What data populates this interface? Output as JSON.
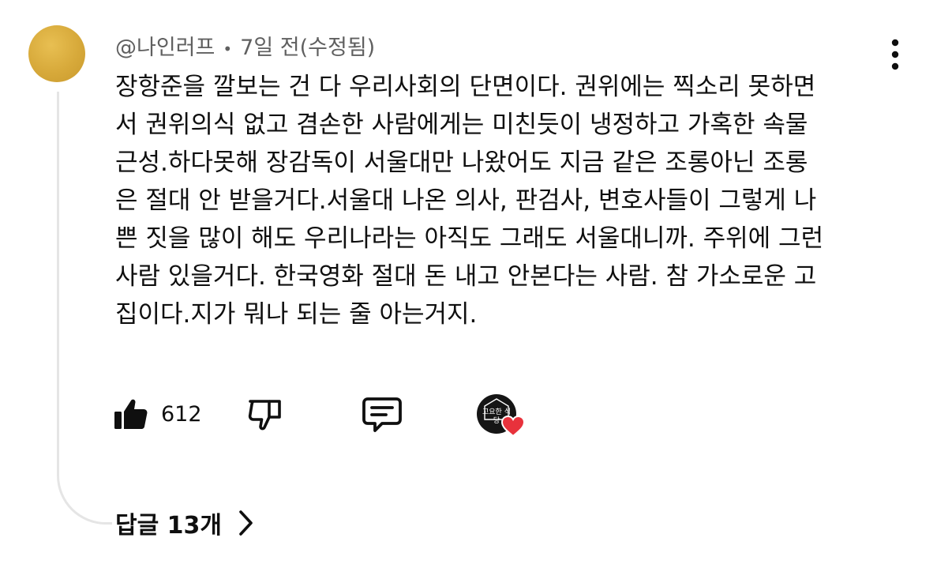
{
  "comment": {
    "author": "@나인러프",
    "separator": "•",
    "time": "7일 전(수정됨)",
    "lines": [
      "장항준을 깔보는 건 다 우리사회의 단면이다. 권위에는 찍소리 못하면",
      "서 권위의식 없고 겸손한 사람에게는 미친듯이 냉정하고 가혹한 속물",
      "근성.하다못해 장감독이 서울대만 나왔어도 지금 같은 조롱아닌 조롱",
      "은 절대 안 받을거다.서울대 나온 의사, 판검사, 변호사들이 그렇게 나",
      "쁜 짓을 많이 해도 우리나라는 아직도 그래도 서울대니까. 주위에 그런",
      "사람 있을거다. 한국영화 절대 돈 내고 안본다는 사람. 참 가소로운 고",
      "집이다.지가 뭐나 되는 줄 아는거지."
    ],
    "like_count": "612",
    "creator_badge_text": "고요한 식당",
    "replies_label": "답글 13개"
  },
  "icons": {
    "avatar": "avatar-circle",
    "more": "more-vertical-icon",
    "like": "thumbs-up-filled-icon",
    "dislike": "thumbs-down-icon",
    "reply": "comment-icon",
    "creator_heart": "heart-icon",
    "replies_chevron": "chevron-right-icon"
  },
  "colors": {
    "avatar": "#d7a93a",
    "meta_text": "#606060",
    "text": "#0f0f0f",
    "heart": "#e8323c",
    "thread_line": "#e5e5e5"
  }
}
